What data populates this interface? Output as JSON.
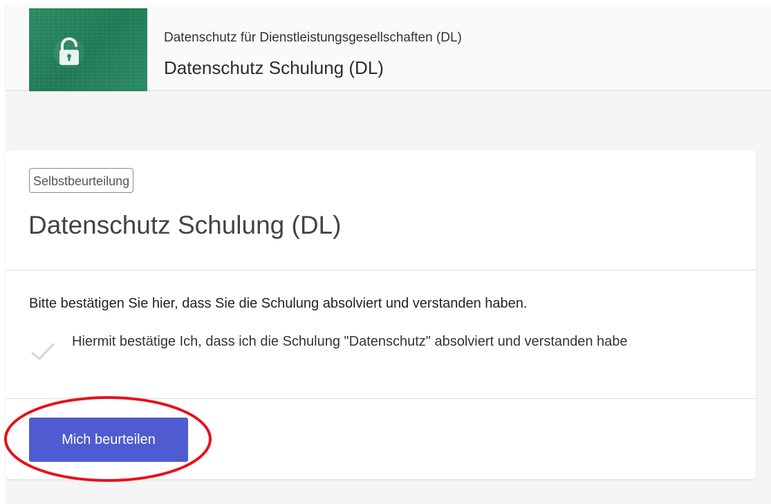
{
  "header": {
    "subtitle": "Datenschutz für Dienstleistungsgesellschaften (DL)",
    "title": "Datenschutz Schulung (DL)",
    "thumbnail_icon": "lock-icon"
  },
  "card": {
    "badge": "Selbstbeurteilung",
    "title": "Datenschutz Schulung (DL)",
    "instruction": "Bitte bestätigen Sie hier, dass Sie die Schulung absolviert und verstanden haben.",
    "confirmation": {
      "icon": "check-icon",
      "text": "Hiermit bestätige Ich, dass ich die Schulung \"Datenschutz\" absolviert und verstanden habe"
    },
    "button_label": "Mich beurteilen"
  },
  "colors": {
    "button": "#4e5bd1",
    "thumbnail": "#2b8a64",
    "annotation_circle": "#e8101a"
  }
}
